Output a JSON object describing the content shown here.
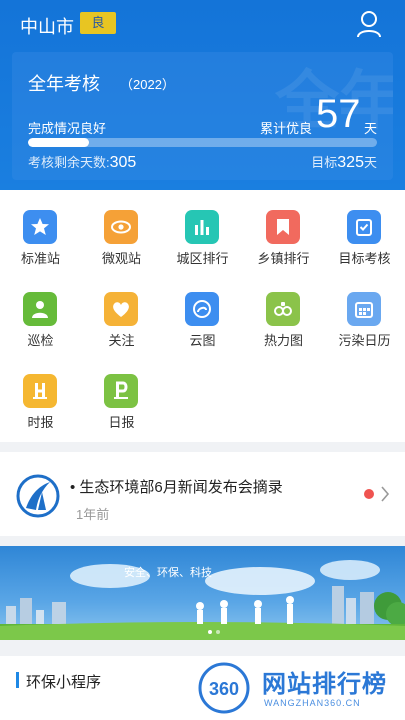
{
  "header": {
    "city": "中山市",
    "aqi_badge": "良",
    "card": {
      "title": "全年考核",
      "year": "（2022）",
      "watermark": "全年",
      "status": "完成情况良好",
      "excellent_label": "累计优良",
      "excellent_days": "57",
      "unit": "天",
      "progress_fraction": 0.175,
      "remaining_label": "考核剩余天数:",
      "remaining_days": "305",
      "target_label": "目标",
      "target_days": "325",
      "target_unit": "天"
    }
  },
  "grid": {
    "items": [
      {
        "label": "标准站",
        "icon": "star-icon",
        "color": "#3d8ef0"
      },
      {
        "label": "微观站",
        "icon": "eye-icon",
        "color": "#f5a137"
      },
      {
        "label": "城区排行",
        "icon": "bar-chart-icon",
        "color": "#26c6b4"
      },
      {
        "label": "乡镇排行",
        "icon": "bookmark-icon",
        "color": "#f16a5e"
      },
      {
        "label": "目标考核",
        "icon": "checklist-icon",
        "color": "#3d8ef0"
      },
      {
        "label": "巡检",
        "icon": "inspector-icon",
        "color": "#66bb3a"
      },
      {
        "label": "关注",
        "icon": "heart-icon",
        "color": "#f5b237"
      },
      {
        "label": "云图",
        "icon": "cloud-map-icon",
        "color": "#3d8ef0"
      },
      {
        "label": "热力图",
        "icon": "heatmap-icon",
        "color": "#8bc34a"
      },
      {
        "label": "污染日历",
        "icon": "calendar-icon",
        "color": "#6aa8f0"
      },
      {
        "label": "时报",
        "icon": "hour-report-icon",
        "color": "#f5b731"
      },
      {
        "label": "日报",
        "icon": "day-report-icon",
        "color": "#7cc243"
      }
    ]
  },
  "news": {
    "title": "• 生态环境部6月新闻发布会摘录",
    "time": "1年前"
  },
  "banner": {
    "text": "安全、环保、科技"
  },
  "mini": {
    "title": "环保小程序"
  },
  "watermark": {
    "text": "网站排行榜",
    "sub": "WANGZHAN360.CN",
    "badge": "360"
  }
}
